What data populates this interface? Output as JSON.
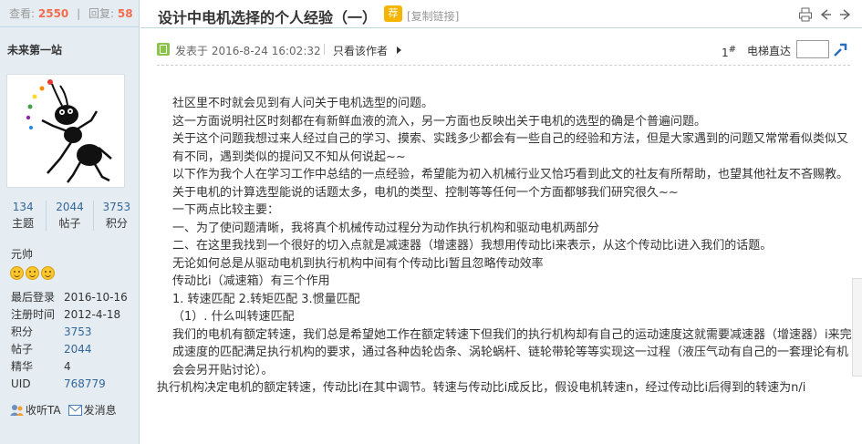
{
  "stats": {
    "views_label": "查看:",
    "views": "2550",
    "replies_label": "回复:",
    "replies": "58"
  },
  "user": {
    "name": "未来第一站",
    "counts": [
      {
        "value": "134",
        "label": "主题"
      },
      {
        "value": "2044",
        "label": "帖子"
      },
      {
        "value": "3753",
        "label": "积分"
      }
    ],
    "rank": "元帅",
    "info": [
      {
        "key": "最后登录",
        "value": "2016-10-16"
      },
      {
        "key": "注册时间",
        "value": "2012-4-18"
      },
      {
        "key": "积分",
        "value": "3753"
      },
      {
        "key": "帖子",
        "value": "2044"
      },
      {
        "key": "精华",
        "value": "4"
      },
      {
        "key": "UID",
        "value": "768779"
      }
    ],
    "actions": {
      "follow": "收听TA",
      "message": "发消息"
    }
  },
  "thread": {
    "title": "设计中电机选择的个人经验（一）",
    "badge": "荐",
    "copy_link": "[复制链接]"
  },
  "post": {
    "date": "发表于 2016-8-24 16:02:32",
    "author_only": "只看该作者",
    "floor": "1",
    "floor_mark": "#",
    "elevator_label": "电梯直达",
    "paragraphs": [
      "社区里不时就会见到有人问关于电机选型的问题。",
      "这一方面说明社区时刻都在有新鲜血液的流入，另一方面也反映出关于电机的选型的确是个普遍问题。",
      "关于这个问题我想过来人经过自己的学习、摸索、实践多少都会有一些自己的经验和方法，但是大家遇到的问题又常常看似类似又有不同，遇到类似的提问又不知从何说起~~",
      "以下作为我个人在学习工作中总结的一点经验，希望能为初入机械行业又恰巧看到此文的社友有所帮助，也望其他社友不吝赐教。",
      "关于电机的计算选型能说的话题太多，电机的类型、控制等等任何一个方面都够我们研究很久~~",
      "一下两点比较主要：",
      "一、为了使问题清晰，我将真个机械传动过程分为动作执行机构和驱动电机两部分",
      "二、在这里我找到一个很好的切入点就是减速器（增速器）我想用传动比i来表示，从这个传动比i进入我们的话题。",
      "无论如何总是从驱动电机到执行机构中间有个传动比i暂且忽略传动效率",
      "传动比i（减速箱）有三个作用",
      "1. 转速匹配  2.转矩匹配  3.惯量匹配",
      "（1）. 什么叫转速匹配",
      "我们的电机有额定转速，我们总是希望她工作在额定转速下但我们的执行机构却有自己的运动速度这就需要减速器（增速器）i来完成速度的匹配满足执行机构的要求，通过各种齿轮齿条、涡轮蜗杆、链轮带轮等等实现这一过程（液压气动有自己的一套理论有机会会另开贴讨论）。",
      "执行机构决定电机的额定转速，传动比i在其中调节。转速与传动比i成反比，假设电机转速n，经过传动比i后得到的转速为n/i"
    ]
  },
  "colors": {
    "link": "#336699",
    "accent": "#f26c4f",
    "sidebar_bg": "#e5edf2",
    "border": "#c2d5e3"
  },
  "icons": [
    "print-icon",
    "prev-arrow-icon",
    "next-arrow-icon",
    "post-icon",
    "elevator-go-icon",
    "follow-icon",
    "message-icon"
  ]
}
